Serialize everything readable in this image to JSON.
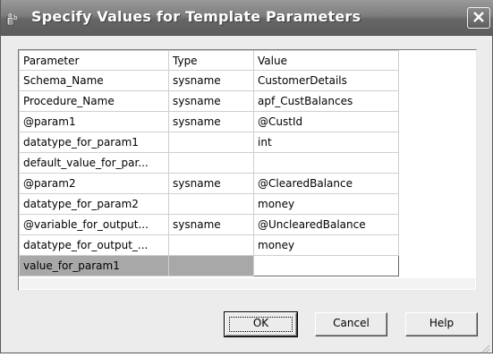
{
  "window": {
    "title": "Specify Values for Template Parameters"
  },
  "grid": {
    "columns": [
      "Parameter",
      "Type",
      "Value"
    ],
    "rows": [
      {
        "parameter": "Schema_Name",
        "type": "sysname",
        "value": "CustomerDetails"
      },
      {
        "parameter": "Procedure_Name",
        "type": "sysname",
        "value": "apf_CustBalances"
      },
      {
        "parameter": "@param1",
        "type": "sysname",
        "value": "@CustId"
      },
      {
        "parameter": "datatype_for_param1",
        "type": "",
        "value": "int"
      },
      {
        "parameter": "default_value_for_par...",
        "type": "",
        "value": ""
      },
      {
        "parameter": "@param2",
        "type": "sysname",
        "value": "@ClearedBalance"
      },
      {
        "parameter": "datatype_for_param2",
        "type": "",
        "value": "money"
      },
      {
        "parameter": "@variable_for_output...",
        "type": "sysname",
        "value": "@UnclearedBalance"
      },
      {
        "parameter": "datatype_for_output_...",
        "type": "",
        "value": "money"
      },
      {
        "parameter": "value_for_param1",
        "type": "",
        "value": "",
        "selected": true
      }
    ]
  },
  "buttons": {
    "ok": "OK",
    "cancel": "Cancel",
    "help": "Help"
  },
  "icons": {
    "app": "template-parameters-icon",
    "close": "close-icon",
    "grip": "resize-grip-icon"
  },
  "colors": {
    "titlebar": "#7d7d7d",
    "selected_row": "#a8a8a8",
    "dialog_bg": "#ececec"
  }
}
